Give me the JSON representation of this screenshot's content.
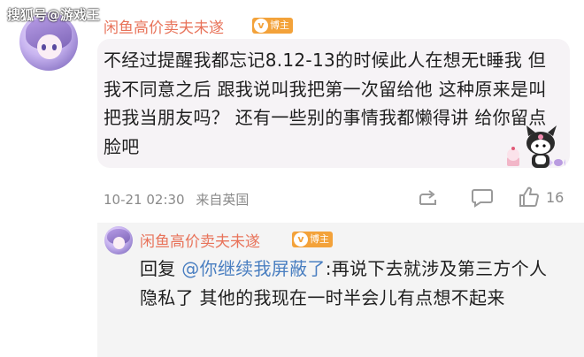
{
  "watermark": "搜狐号@游戏王",
  "comment": {
    "username": "闲鱼高价卖夫未遂",
    "badge": "博主",
    "text": "不经过提醒我都忘记8.12-13的时候此人在想无t睡我 但我不同意之后 跟我说叫我把第一次留给他 这种原来是叫把我当朋友吗？ 还有一些别的事情我都懒得讲 给你留点脸吧",
    "timestamp": "10-21 02:30",
    "location": "来自英国",
    "like_count": "16",
    "icons": [
      "share-icon",
      "comment-icon",
      "like-icon"
    ]
  },
  "reply": {
    "username": "闲鱼高价卖夫未遂",
    "badge": "博主",
    "prefix": "回复",
    "mention": "@你继续我屏蔽了",
    "text": ":再说下去就涉及第三方个人隐私了 其他的我现在一时半会儿有点想不起来"
  },
  "colors": {
    "username": "#e8735a",
    "badge": "#f3a23a",
    "mention": "#4a7fc1",
    "meta": "#8a8a8a"
  }
}
